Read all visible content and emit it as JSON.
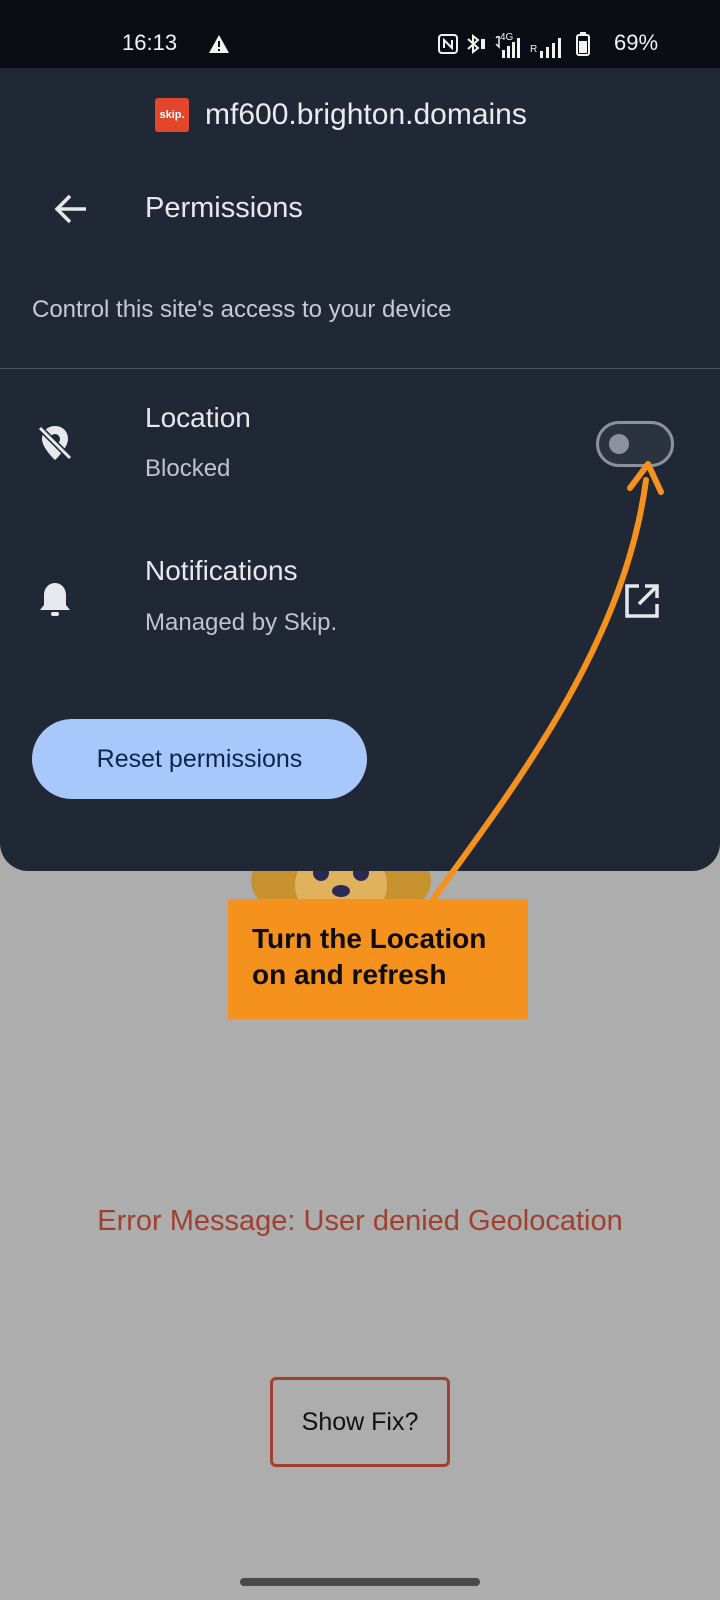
{
  "status_bar": {
    "time": "16:13",
    "network": "4G",
    "roaming": "R",
    "battery_percent": "69%"
  },
  "sheet": {
    "favicon_text": "skip.",
    "site": "mf600.brighton.domains",
    "title": "Permissions",
    "description": "Control this site's access to your device",
    "permissions": [
      {
        "label": "Location",
        "status": "Blocked",
        "icon": "location-off-icon",
        "control": "toggle",
        "enabled": false
      },
      {
        "label": "Notifications",
        "status": "Managed by Skip.",
        "icon": "bell-icon",
        "control": "open-external-icon"
      }
    ],
    "reset_button": "Reset permissions"
  },
  "callout": {
    "line1": "Turn the Location",
    "line2": "on and refresh",
    "color": "#f5921e"
  },
  "page": {
    "error": "Error Message: User denied Geolocation",
    "fix_button": "Show Fix?"
  },
  "colors": {
    "sheet_bg": "#212835",
    "button_bg": "#a8c7fa",
    "page_bg": "#adadad",
    "error_text": "#a0412f"
  }
}
